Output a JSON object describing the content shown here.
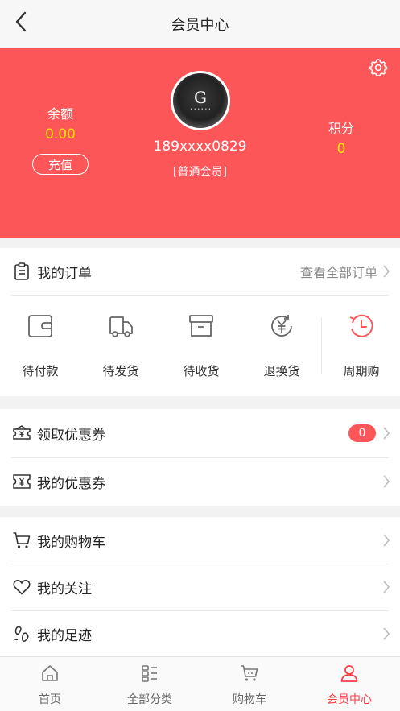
{
  "header": {
    "title": "会员中心"
  },
  "profile": {
    "phone": "189xxxx0829",
    "level": "[普通会员]",
    "balance_label": "余额",
    "balance_value": "0.00",
    "recharge_label": "充值",
    "points_label": "积分",
    "points_value": "0"
  },
  "orders": {
    "title": "我的订单",
    "view_all": "查看全部订单",
    "statuses": [
      {
        "label": "待付款",
        "icon": "wallet-icon"
      },
      {
        "label": "待发货",
        "icon": "truck-icon"
      },
      {
        "label": "待收货",
        "icon": "box-icon"
      },
      {
        "label": "退换货",
        "icon": "yen-return-icon"
      },
      {
        "label": "周期购",
        "icon": "clock-cycle-icon"
      }
    ]
  },
  "coupons": {
    "claim_label": "领取优惠券",
    "claim_count": "0",
    "mine_label": "我的优惠券"
  },
  "misc": {
    "cart_label": "我的购物车",
    "follow_label": "我的关注",
    "history_label": "我的足迹"
  },
  "tabbar": {
    "items": [
      {
        "label": "首页",
        "icon": "home-icon"
      },
      {
        "label": "全部分类",
        "icon": "category-icon"
      },
      {
        "label": "购物车",
        "icon": "cart-icon"
      },
      {
        "label": "会员中心",
        "icon": "user-icon"
      }
    ],
    "active": "会员中心"
  },
  "colors": {
    "brand": "#fc5659",
    "highlight": "#ffe100",
    "accent": "#fc3d46"
  }
}
